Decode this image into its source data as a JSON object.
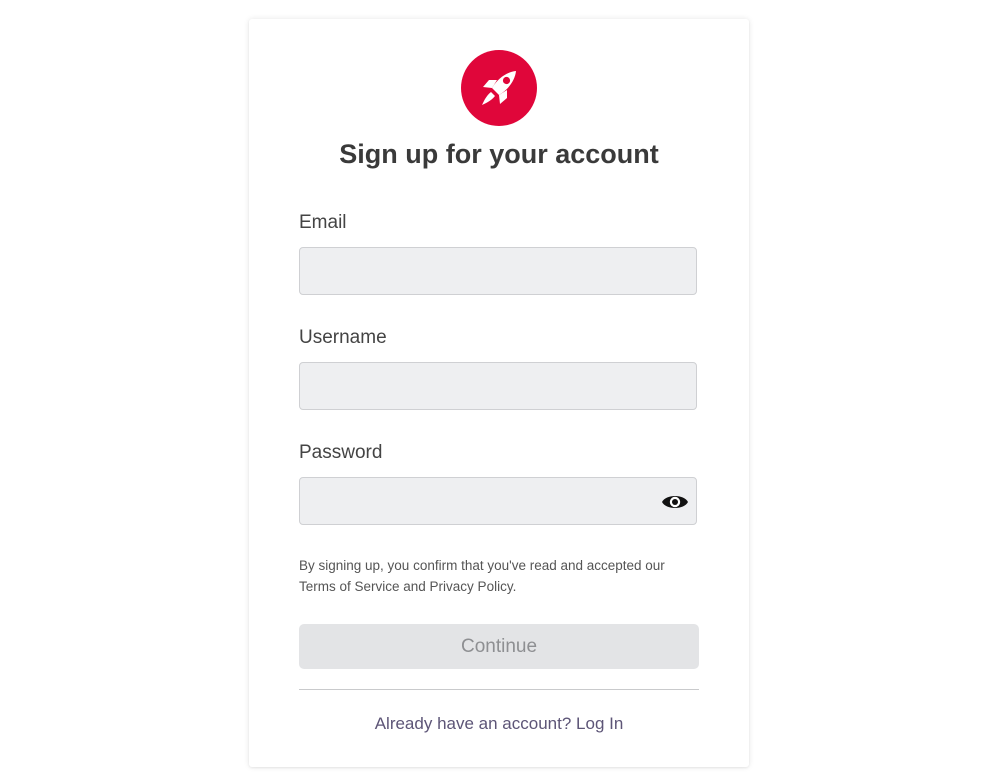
{
  "brand": {
    "logo_icon": "rocket-icon",
    "logo_color": "#e0063a"
  },
  "form": {
    "title": "Sign up for your account",
    "email": {
      "label": "Email",
      "value": "",
      "placeholder": ""
    },
    "username": {
      "label": "Username",
      "value": "",
      "placeholder": ""
    },
    "password": {
      "label": "Password",
      "value": "",
      "placeholder": "",
      "toggle_icon": "eye-icon"
    },
    "legal_text": "By signing up, you confirm that you've read and accepted our Terms of Service and Privacy Policy.",
    "continue_label": "Continue",
    "continue_enabled": false,
    "login_prompt": "Already have an account?",
    "login_link": "Log In"
  },
  "colors": {
    "accent": "#e0063a",
    "input_bg": "#eeeff1",
    "button_disabled_bg": "#e3e4e6",
    "button_disabled_text": "#8e8f92",
    "link_text": "#5d5577"
  }
}
